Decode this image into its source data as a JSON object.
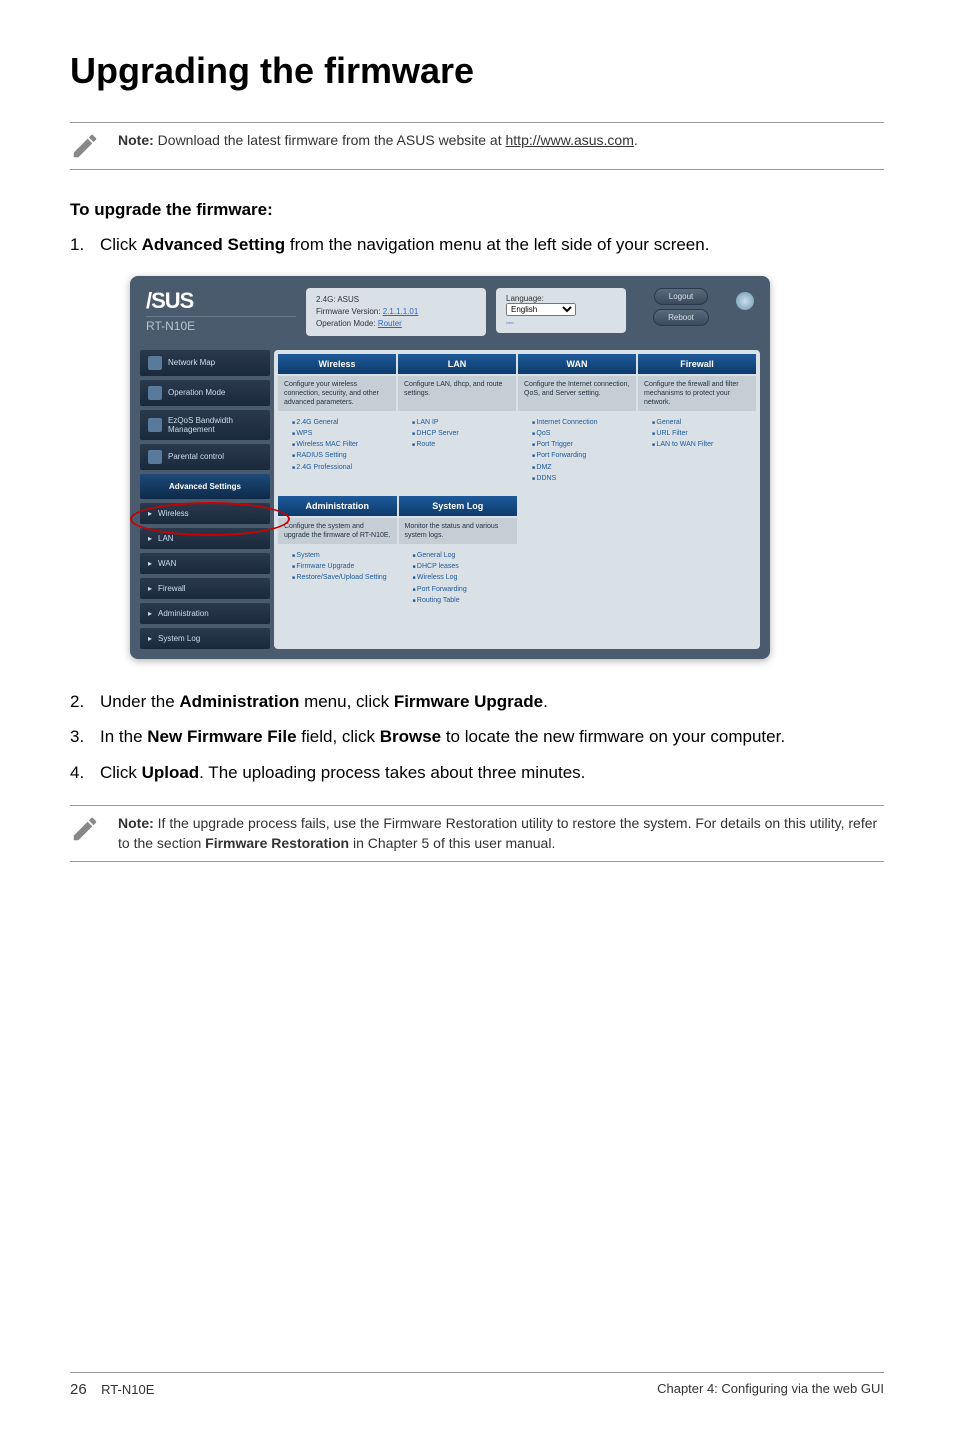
{
  "title": "Upgrading the firmware",
  "note1": {
    "label": "Note:",
    "text": "Download the latest firmware from the ASUS website at ",
    "link": "http://www.asus.com",
    "suffix": "."
  },
  "subheading": "To upgrade the firmware:",
  "steps": {
    "s1_num": "1.",
    "s1": "Click Advanced Setting from the navigation menu at the left side of your screen.",
    "s2_num": "2.",
    "s2": "Under the Administration menu, click Firmware Upgrade.",
    "s3_num": "3.",
    "s3": "In the New Firmware File field, click Browse to locate the new firmware on your computer.",
    "s4_num": "4.",
    "s4": "Click Upload. The uploading process takes about three minutes."
  },
  "note2": {
    "label": "Note:",
    "text": "If the upgrade process fails, use the Firmware Restoration utility to restore the system. For details on this utility, refer to the section Firmware Restoration in Chapter 5 of this user manual."
  },
  "screenshot": {
    "brand": "/SUS",
    "model": "RT-N10E",
    "status": {
      "ghz": "2.4G: ASUS",
      "fw_label": "Firmware Version:",
      "fw": "2.1.1.1.01",
      "mode_label": "Operation Mode:",
      "mode": "Router"
    },
    "lang_label": "Language:",
    "lang": "English",
    "logout": "Logout",
    "reboot": "Reboot",
    "sidebar": {
      "network_map": "Network Map",
      "operation_mode": "Operation Mode",
      "ezqos": "EzQoS Bandwidth Management",
      "parental": "Parental control",
      "advanced": "Advanced Settings",
      "wireless": "Wireless",
      "lan": "LAN",
      "wan": "WAN",
      "firewall": "Firewall",
      "admin": "Administration",
      "syslog": "System Log"
    },
    "panels": {
      "wireless": {
        "title": "Wireless",
        "desc": "Configure your wireless connection, security, and other advanced parameters.",
        "items": [
          "2.4G General",
          "WPS",
          "Wireless MAC Filter",
          "RADIUS Setting",
          "2.4G Professional"
        ]
      },
      "lan": {
        "title": "LAN",
        "desc": "Configure LAN, dhcp, and route settings.",
        "items": [
          "LAN IP",
          "DHCP Server",
          "Route"
        ]
      },
      "wan": {
        "title": "WAN",
        "desc": "Configure the Internet connection, QoS, and Server setting.",
        "items": [
          "Internet Connection",
          "QoS",
          "Port Trigger",
          "Port Forwarding",
          "DMZ",
          "DDNS"
        ]
      },
      "firewall": {
        "title": "Firewall",
        "desc": "Configure the firewall and filter mechanisms to protect your network.",
        "items": [
          "General",
          "URL Filter",
          "LAN to WAN Filter"
        ]
      },
      "admin": {
        "title": "Administration",
        "desc": "Configure the system and upgrade the firmware of RT-N10E.",
        "items": [
          "System",
          "Firmware Upgrade",
          "Restore/Save/Upload Setting"
        ]
      },
      "syslog": {
        "title": "System Log",
        "desc": "Monitor the status and various system logs.",
        "items": [
          "General Log",
          "DHCP leases",
          "Wireless Log",
          "Port Forwarding",
          "Routing Table"
        ]
      }
    }
  },
  "footer": {
    "page": "26",
    "model": "RT-N10E",
    "chapter": "Chapter 4: Configuring via the web GUI"
  }
}
